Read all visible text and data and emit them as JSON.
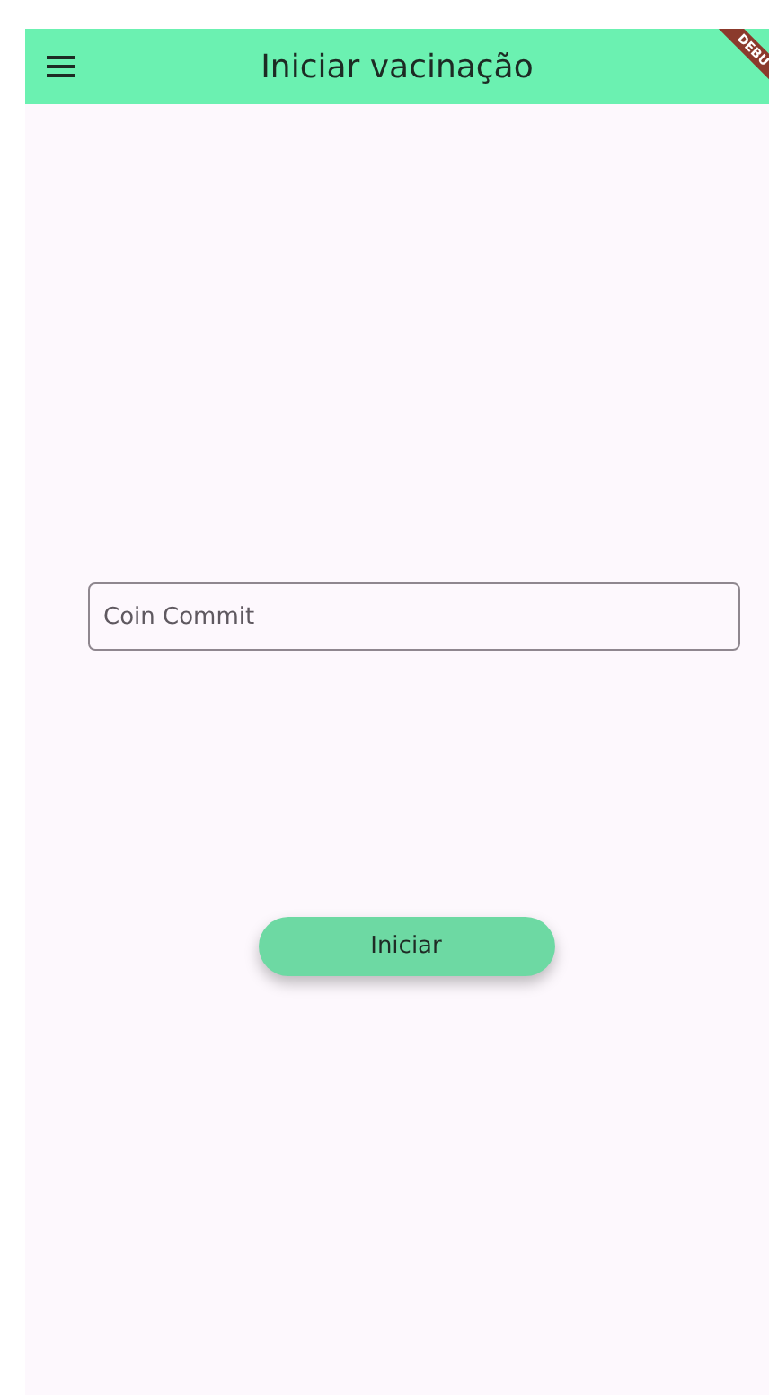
{
  "app_bar": {
    "title": "Iniciar vacinação",
    "debug_banner": "DEBU"
  },
  "field": {
    "placeholder": "Coin Commit"
  },
  "button": {
    "label": "Iniciar"
  }
}
